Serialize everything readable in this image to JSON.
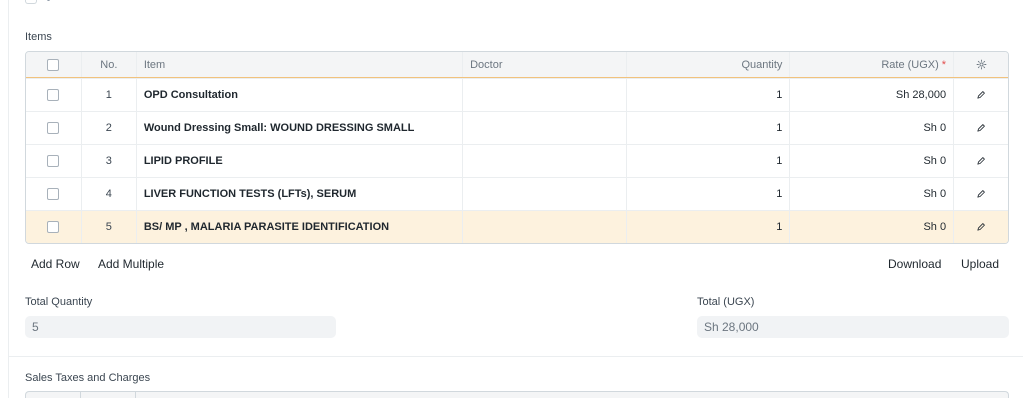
{
  "items_section": {
    "label": "Items",
    "columns": {
      "no": "No.",
      "item": "Item",
      "doctor": "Doctor",
      "quantity": "Quantity",
      "rate": "Rate (UGX)",
      "rate_required_mark": "*"
    },
    "rows": [
      {
        "no": "1",
        "item": "OPD Consultation",
        "doctor": "",
        "quantity": "1",
        "rate": "Sh 28,000"
      },
      {
        "no": "2",
        "item": "Wound Dressing Small: WOUND DRESSING SMALL",
        "doctor": "",
        "quantity": "1",
        "rate": "Sh 0"
      },
      {
        "no": "3",
        "item": "LIPID PROFILE",
        "doctor": "",
        "quantity": "1",
        "rate": "Sh 0"
      },
      {
        "no": "4",
        "item": "LIVER FUNCTION TESTS (LFTs), SERUM",
        "doctor": "",
        "quantity": "1",
        "rate": "Sh 0"
      },
      {
        "no": "5",
        "item": "BS/ MP , MALARIA PARASITE IDENTIFICATION",
        "doctor": "",
        "quantity": "1",
        "rate": "Sh 0"
      }
    ],
    "highlighted_row": 5
  },
  "actions": {
    "add_row": "Add Row",
    "add_multiple": "Add Multiple",
    "download": "Download",
    "upload": "Upload"
  },
  "totals": {
    "total_quantity_label": "Total Quantity",
    "total_quantity_value": "5",
    "total_label": "Total (UGX)",
    "total_value": "Sh 28,000"
  },
  "taxes_section": {
    "label": "Sales Taxes and Charges"
  },
  "icons": {
    "settings": "gear-icon",
    "edit": "pencil-icon"
  },
  "colors": {
    "highlight_row": "#fdf2de",
    "header_underline": "#f1c27d",
    "required": "#e24c4c"
  }
}
